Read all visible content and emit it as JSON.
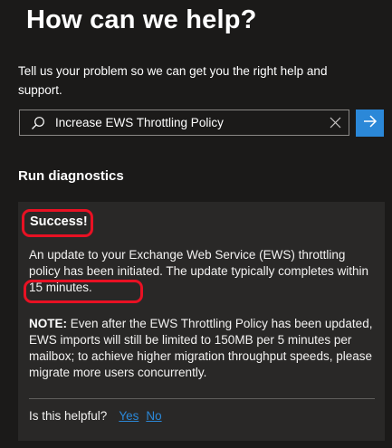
{
  "header": {
    "title": "How can we help?",
    "subtitle": "Tell us your problem so we can get you the right help and support."
  },
  "search": {
    "value": "Increase EWS Throttling Policy",
    "icons": {
      "search": "search-icon",
      "clear": "close-icon",
      "submit": "arrow-right-icon"
    }
  },
  "diagnostics": {
    "heading": "Run diagnostics",
    "result_title": "Success!",
    "message_part1": "An update to your Exchange Web Service (EWS) throttling policy has been initiated. The update typically completes ",
    "message_highlight": "within 15 minutes.",
    "note_label": "NOTE:",
    "note_text": " Even after the EWS Throttling Policy has been updated, EWS imports will still be limited to 150MB per 5 minutes per mailbox; to achieve higher migration throughput speeds, please migrate more users concurrently."
  },
  "feedback": {
    "question": "Is this helpful?",
    "yes": "Yes",
    "no": "No"
  },
  "colors": {
    "background": "#1b1a19",
    "panel": "#292827",
    "accent": "#2b88d8",
    "highlight": "#e81123"
  }
}
